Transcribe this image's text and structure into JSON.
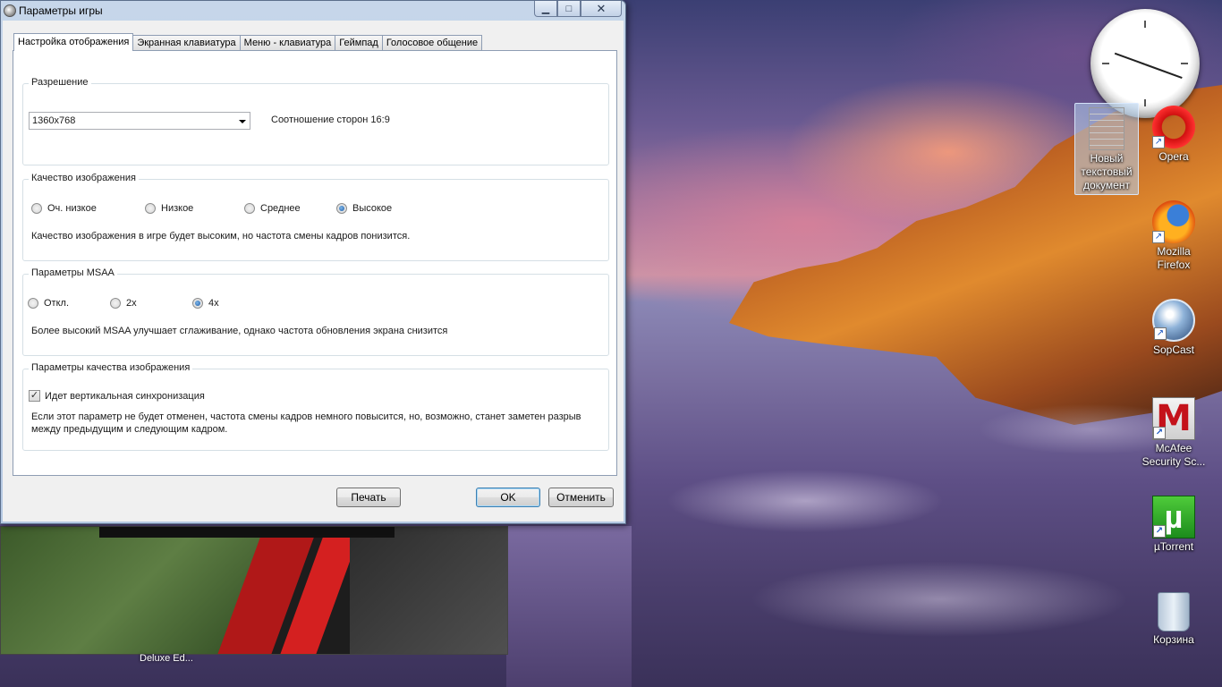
{
  "window": {
    "title": "Параметры игры",
    "min_glyph": "▁",
    "max_glyph": "□",
    "close_glyph": "✕"
  },
  "tabs": [
    {
      "label": "Настройка отображения",
      "active": true
    },
    {
      "label": "Экранная клавиатура",
      "active": false
    },
    {
      "label": "Меню - клавиатура",
      "active": false
    },
    {
      "label": "Геймпад",
      "active": false
    },
    {
      "label": "Голосовое общение",
      "active": false
    }
  ],
  "resolution": {
    "legend": "Разрешение",
    "value": "1360x768",
    "aspect_text": "Соотношение сторон 16:9"
  },
  "image_quality": {
    "legend": "Качество изображения",
    "options": [
      {
        "label": "Оч. низкое",
        "selected": false
      },
      {
        "label": "Низкое",
        "selected": false
      },
      {
        "label": "Среднее",
        "selected": false
      },
      {
        "label": "Высокое",
        "selected": true
      }
    ],
    "note": "Качество изображения в игре будет высоким, но частота смены кадров понизится."
  },
  "msaa": {
    "legend": "Параметры MSAA",
    "options": [
      {
        "label": "Откл.",
        "selected": false
      },
      {
        "label": "2x",
        "selected": false
      },
      {
        "label": "4x",
        "selected": true
      }
    ],
    "note": "Более высокий MSAA улучшает сглаживание, однако частота обновления экрана снизится"
  },
  "quality_params": {
    "legend": "Параметры качества изображения",
    "vsync_label": "Идет вертикальная синхронизация",
    "vsync_checked": true,
    "check_glyph": "✓",
    "note_line1": "Если этот параметр не будет отменен, частота смены кадров немного повысится, но, возможно, станет заметен разрыв",
    "note_line2": "между предыдущим и следующим кадром."
  },
  "buttons": {
    "print": "Печать",
    "ok": "OK",
    "cancel": "Отменить"
  },
  "background_window": {
    "caption": "Deluxe Ed..."
  },
  "desktop_icons": {
    "text_doc_line1": "Новый",
    "text_doc_line2": "текстовый",
    "text_doc_line3": "документ",
    "opera": "Opera",
    "firefox_line1": "Mozilla",
    "firefox_line2": "Firefox",
    "sopcast": "SopCast",
    "mcafee_line1": "McAfee",
    "mcafee_line2": "Security Sc...",
    "mcafee_glyph": "M",
    "utorrent": "µTorrent",
    "utorrent_glyph": "µ",
    "recycle_bin": "Корзина",
    "shortcut_glyph": "↗"
  },
  "icons": [
    "app-icon",
    "minimize-icon",
    "maximize-icon",
    "close-icon",
    "dropdown-arrow-icon",
    "checkbox-check-icon",
    "clock-gadget",
    "text-document-icon",
    "opera-icon",
    "firefox-icon",
    "sopcast-icon",
    "mcafee-icon",
    "utorrent-icon",
    "recycle-bin-icon",
    "shortcut-arrow-icon"
  ],
  "colors": {
    "window_frame": "#b4c8e2",
    "default_button_border": "#3c7fb1",
    "radio_selected": "#1a5aa8"
  }
}
